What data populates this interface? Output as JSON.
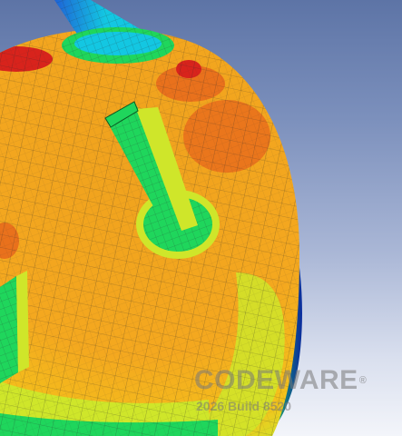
{
  "viewport": {
    "background_top": "#5d74a6",
    "background_bottom": "#f3f5fa"
  },
  "model": {
    "contour_colors": [
      "#0a2a9e",
      "#1e63d6",
      "#13c7e2",
      "#1fd65c",
      "#cfe62a",
      "#f4c21b",
      "#f0a21e",
      "#e9711c",
      "#d8231c"
    ],
    "mesh_color": "#2a2a2a"
  },
  "watermark": {
    "logo": "CODEWARE",
    "registered": "®",
    "build": "2026 Build 8520"
  }
}
